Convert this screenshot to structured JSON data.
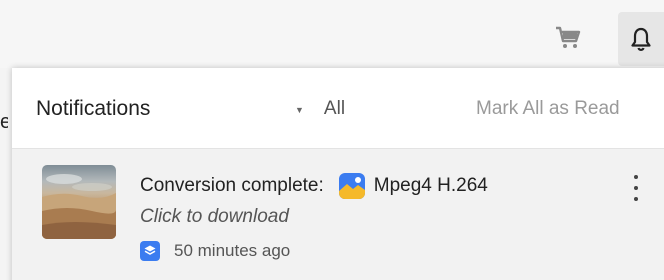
{
  "topbar": {
    "cart_icon": "shopping-cart-icon",
    "bell_icon": "bell-icon",
    "edge_text": "e"
  },
  "notifications": {
    "title": "Notifications",
    "filter": {
      "selected": "All",
      "caret_icon": "caret-down-icon"
    },
    "mark_all_label": "Mark All as Read",
    "items": [
      {
        "thumbnail": "landscape-thumbnail",
        "title": "Conversion complete:",
        "format_icon": "image-format-icon",
        "format": "Mpeg4 H.264",
        "subtitle": "Click to download",
        "time_icon": "layers-icon",
        "time": "50 minutes ago",
        "menu_icon": "more-vertical-icon"
      }
    ]
  },
  "colors": {
    "accent_blue": "#3b7cf0",
    "format_icon_yellow": "#f5b92a",
    "muted_text": "#9a9a9a"
  }
}
